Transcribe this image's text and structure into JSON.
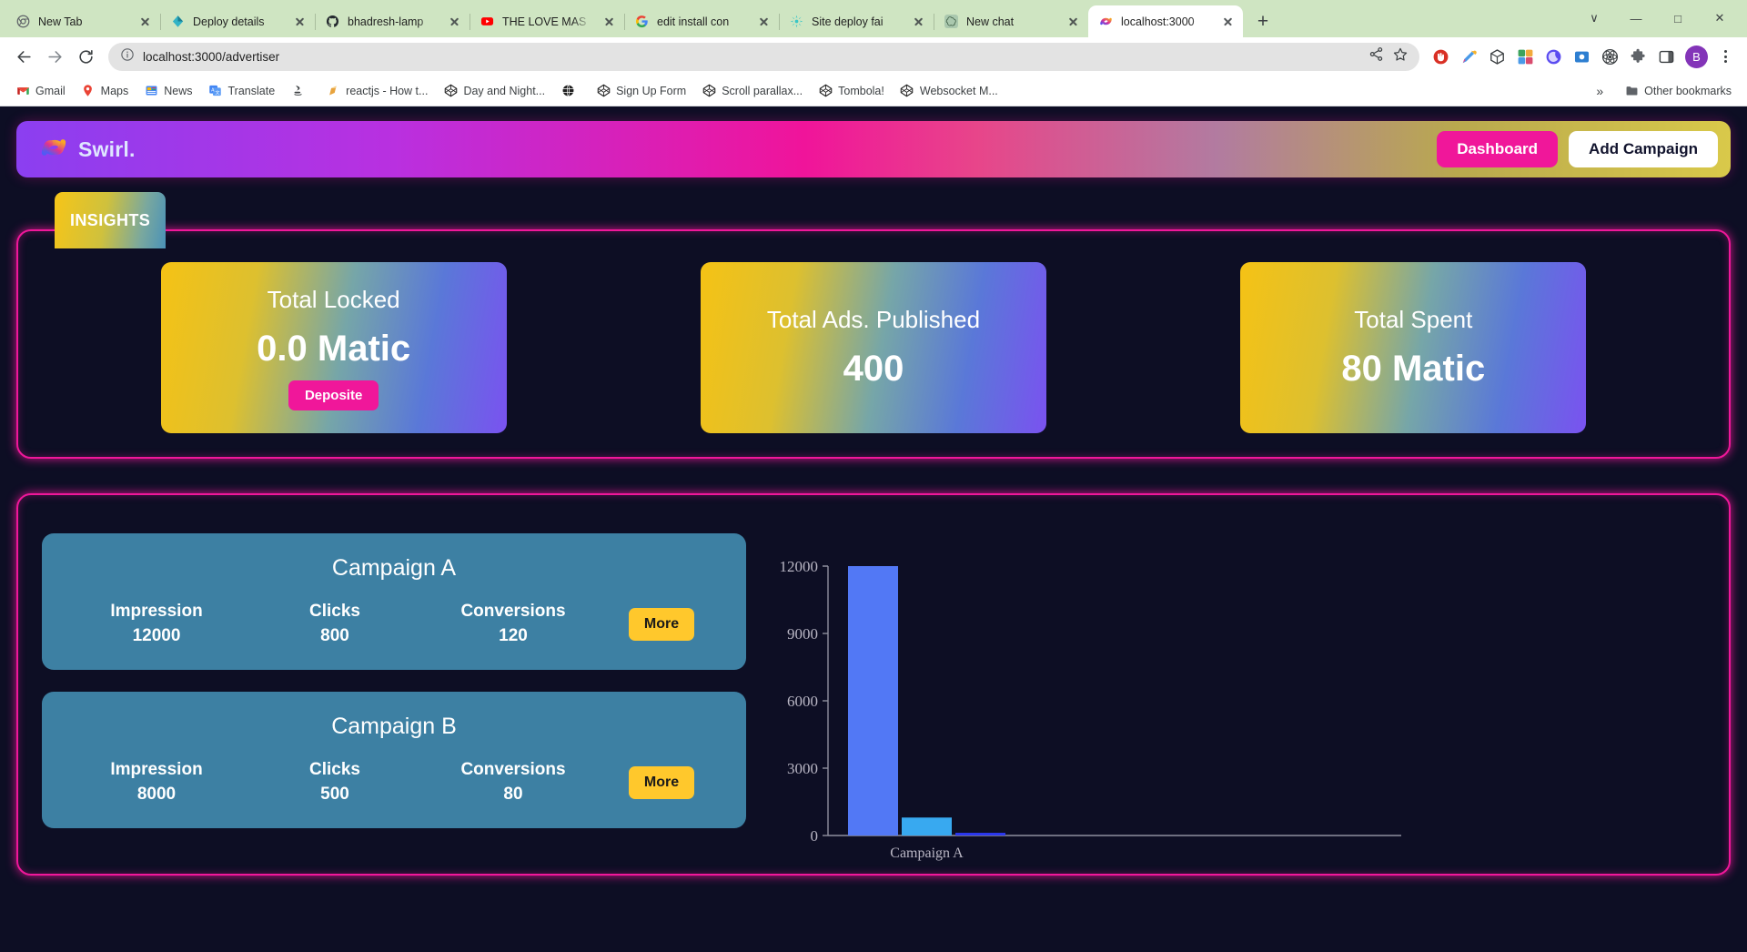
{
  "browser": {
    "tabs": [
      {
        "title": "New Tab",
        "favicon": "chrome-icon",
        "active": false
      },
      {
        "title": "Deploy details",
        "favicon": "netlify-icon",
        "active": false
      },
      {
        "title": "bhadresh-lamp",
        "favicon": "github-icon",
        "active": false
      },
      {
        "title": "THE LOVE MAS",
        "favicon": "youtube-icon",
        "active": false
      },
      {
        "title": "edit install con",
        "favicon": "google-icon",
        "active": false
      },
      {
        "title": "Site deploy fai",
        "favicon": "sparkle-icon",
        "active": false
      },
      {
        "title": "New chat",
        "favicon": "openai-icon",
        "active": false
      },
      {
        "title": "localhost:3000",
        "favicon": "swirl-icon",
        "active": true
      }
    ],
    "new_tab_label": "+",
    "window_controls": {
      "minimize": "—",
      "maximize": "□",
      "close": "✕",
      "expand": "∨"
    },
    "nav": {
      "back": "back-arrow",
      "forward": "forward-arrow",
      "reload": "reload"
    },
    "omnibox": {
      "url": "localhost:3000/advertiser",
      "site_info": "info-circle-icon",
      "share": "share-icon",
      "bookmark": "star-icon"
    },
    "extensions": [
      "adblock-icon",
      "eyedropper-icon",
      "box-icon",
      "puzzle-colored-icon",
      "moon-icon",
      "screenshot-icon",
      "react-icon",
      "extensions-icon",
      "sidepanel-icon"
    ],
    "profile_initial": "B",
    "menu": "kebab-menu-icon",
    "bookmarks": [
      {
        "label": "Gmail",
        "icon": "gmail-icon"
      },
      {
        "label": "Maps",
        "icon": "maps-icon"
      },
      {
        "label": "News",
        "icon": "news-icon"
      },
      {
        "label": "Translate",
        "icon": "translate-icon"
      },
      {
        "label": "",
        "icon": "java-icon"
      },
      {
        "label": "reactjs - How t...",
        "icon": "doc-icon"
      },
      {
        "label": "Day and Night...",
        "icon": "codepen-icon"
      },
      {
        "label": "",
        "icon": "globe-icon"
      },
      {
        "label": "Sign Up Form",
        "icon": "codepen-icon"
      },
      {
        "label": "Scroll parallax...",
        "icon": "codepen-icon"
      },
      {
        "label": "Tombola!",
        "icon": "codepen-icon"
      },
      {
        "label": "Websocket M...",
        "icon": "codepen-icon"
      }
    ],
    "bookmarks_overflow": "»",
    "other_bookmarks": {
      "label": "Other bookmarks",
      "icon": "folder-icon"
    }
  },
  "app": {
    "brand": {
      "name": "Swirl.",
      "icon": "swirl-logo-icon"
    },
    "header_buttons": {
      "dashboard": "Dashboard",
      "add_campaign": "Add Campaign"
    },
    "insights": {
      "tab_label": "INSIGHTS",
      "cards": [
        {
          "title": "Total Locked",
          "value": "0.0 Matic",
          "action": "Deposite"
        },
        {
          "title": "Total Ads. Published",
          "value": "400",
          "action": null
        },
        {
          "title": "Total Spent",
          "value": "80 Matic",
          "action": null
        }
      ]
    },
    "campaigns": {
      "stat_labels": [
        "Impression",
        "Clicks",
        "Conversions"
      ],
      "more_label": "More",
      "list": [
        {
          "name": "Campaign A",
          "impression": "12000",
          "clicks": "800",
          "conversions": "120"
        },
        {
          "name": "Campaign B",
          "impression": "8000",
          "clicks": "500",
          "conversions": "80"
        }
      ]
    }
  },
  "chart_data": {
    "type": "bar",
    "title": "",
    "xlabel": "",
    "ylabel": "",
    "categories": [
      "Campaign A"
    ],
    "x_tick_labels": [
      "Campaign A"
    ],
    "y_tick_labels": [
      "0",
      "3000",
      "6000",
      "9000",
      "12000"
    ],
    "y_ticks": [
      0,
      3000,
      6000,
      9000,
      12000
    ],
    "ylim": [
      0,
      12000
    ],
    "grid": false,
    "legend": false,
    "series": [
      {
        "name": "Impression",
        "values": [
          12000
        ],
        "color": "#5278f5"
      },
      {
        "name": "Clicks",
        "values": [
          800
        ],
        "color": "#38a9f0"
      },
      {
        "name": "Conversions",
        "values": [
          120
        ],
        "color": "#2b38ef"
      }
    ],
    "axis_color": "#8f8f9e",
    "tick_label_color": "#b9b6c4"
  },
  "colors": {
    "app_bg": "#0d0e24",
    "neon_pink": "#f0179a",
    "card_blue": "#3d80a3",
    "more_yellow": "#ffc82c",
    "tabstrip_green": "#cfe5c2"
  }
}
